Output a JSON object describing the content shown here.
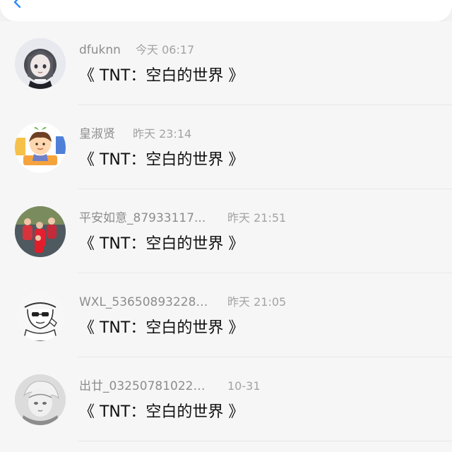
{
  "colors": {
    "background": "#f6f6f6",
    "top_card": "#ffffff",
    "name_text": "#8d8d8d",
    "time_text": "#a3a3a3",
    "message_text": "#101010",
    "back_icon": "#2f8cff",
    "divider": "#e7e7e7"
  },
  "header": {
    "back_icon": "back-arrow-icon"
  },
  "messages": [
    {
      "name": "dfuknn",
      "time": "今天 06:17",
      "text": "《 TNT：空白的世界 》",
      "avatar_icon": "anime-girl-avatar"
    },
    {
      "name": "皇淑贤",
      "time": "昨天 23:14",
      "text": "《 TNT：空白的世界 》",
      "avatar_icon": "cartoon-boy-avatar"
    },
    {
      "name": "平安如意_87933117...",
      "time": "昨天 21:51",
      "text": "《 TNT：空白的世界 》",
      "avatar_icon": "family-photo-avatar"
    },
    {
      "name": "WXL_536508932288...",
      "time": "昨天 21:05",
      "text": "《 TNT：空白的世界 》",
      "avatar_icon": "sketch-person-avatar"
    },
    {
      "name": "出廿_032507810227...",
      "time": "10-31",
      "text": "《 TNT：空白的世界 》",
      "avatar_icon": "grey-anime-avatar"
    }
  ]
}
